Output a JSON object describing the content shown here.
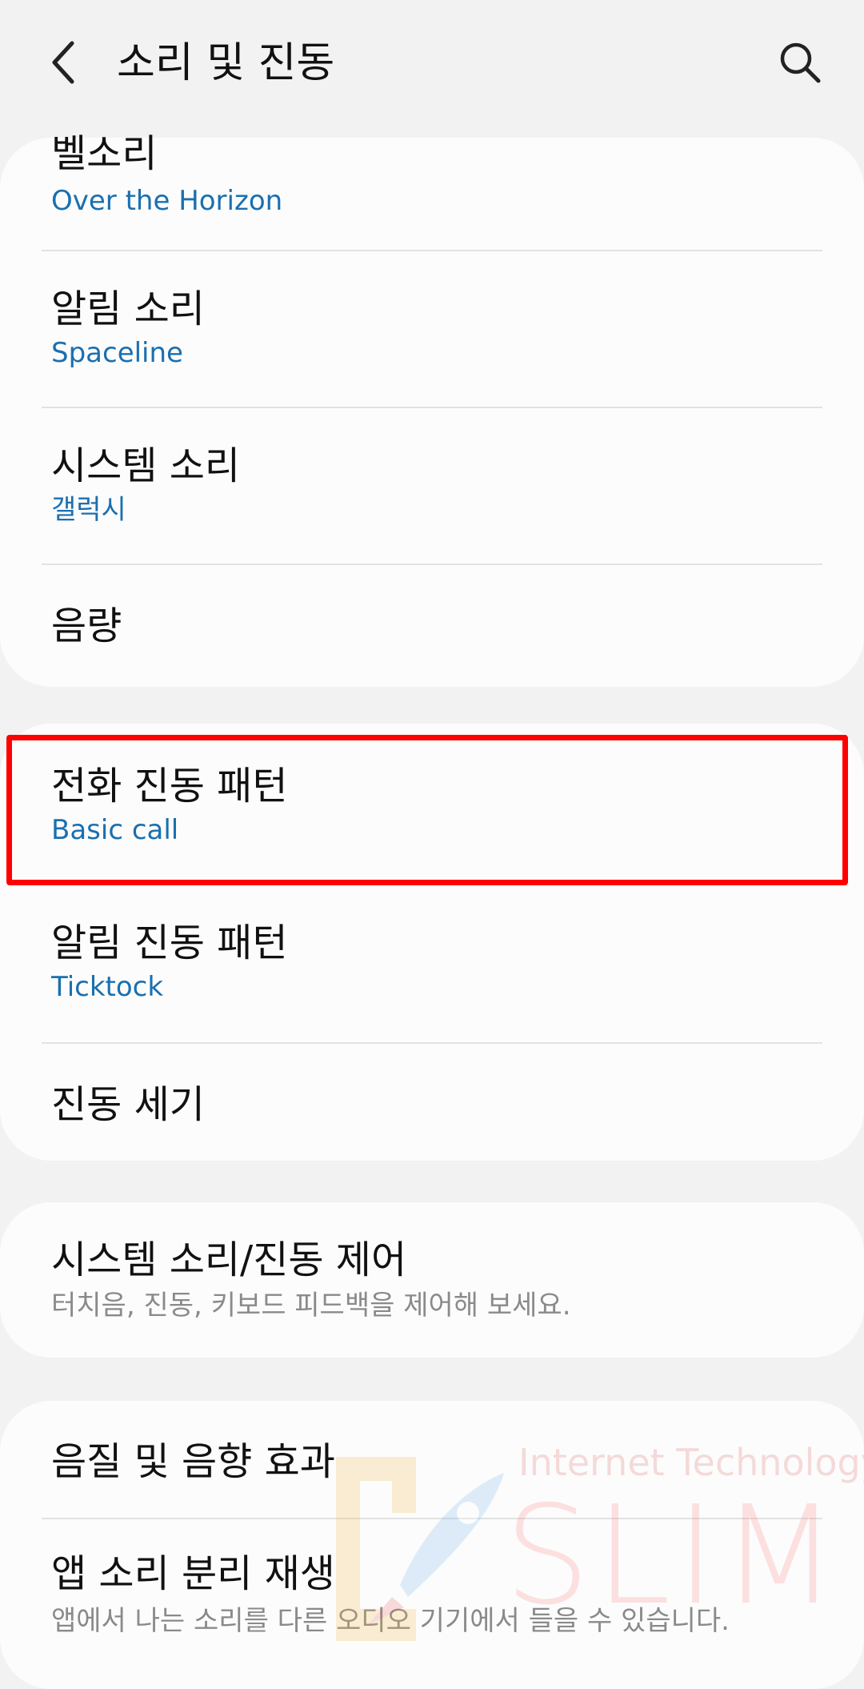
{
  "header": {
    "title": "소리 및 진동"
  },
  "icons": {
    "back": "chevron-left-icon",
    "search": "search-icon"
  },
  "colors": {
    "background": "#f2f2f2",
    "card": "#fcfcfc",
    "subtitle_blue": "#1a6fb0",
    "subtitle_grey": "#8a8a8a",
    "highlight": "#ff0000"
  },
  "groups": [
    {
      "items": [
        {
          "title": "벨소리",
          "subtitle": "Over the Horizon"
        },
        {
          "title": "알림 소리",
          "subtitle": "Spaceline"
        },
        {
          "title": "시스템 소리",
          "subtitle": "갤럭시"
        },
        {
          "title": "음량"
        }
      ]
    },
    {
      "items": [
        {
          "title": "전화 진동 패턴",
          "subtitle": "Basic call"
        },
        {
          "title": "알림 진동 패턴",
          "subtitle": "Ticktock"
        },
        {
          "title": "진동 세기"
        }
      ]
    },
    {
      "items": [
        {
          "title": "시스템 소리/진동 제어",
          "subtitle": "터치음, 진동, 키보드 피드백을 제어해 보세요."
        }
      ]
    },
    {
      "items": [
        {
          "title": "음질 및 음향 효과"
        },
        {
          "title": "앱 소리 분리 재생",
          "subtitle": "앱에서 나는 소리를 다른 오디오 기기에서 들을 수 있습니다."
        }
      ]
    }
  ],
  "watermark": {
    "tagline": "Internet Technology",
    "brand": "SLIM"
  }
}
